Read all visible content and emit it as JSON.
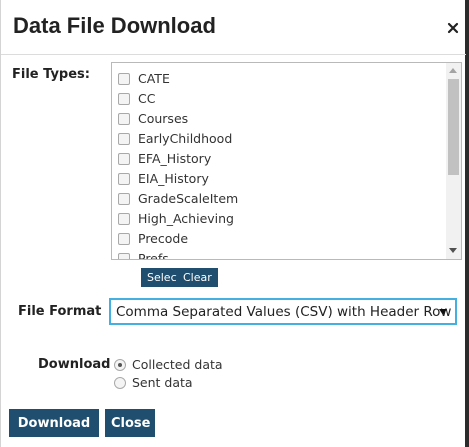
{
  "dialog": {
    "title": "Data File Download",
    "close_symbol": "×"
  },
  "file_types": {
    "label": "File Types:",
    "items": [
      {
        "label": "CATE",
        "checked": false
      },
      {
        "label": "CC",
        "checked": false
      },
      {
        "label": "Courses",
        "checked": false
      },
      {
        "label": "EarlyChildhood",
        "checked": false
      },
      {
        "label": "EFA_History",
        "checked": false
      },
      {
        "label": "EIA_History",
        "checked": false
      },
      {
        "label": "GradeScaleItem",
        "checked": false
      },
      {
        "label": "High_Achieving",
        "checked": false
      },
      {
        "label": "Precode",
        "checked": false
      },
      {
        "label": "Prefs",
        "checked": false
      }
    ],
    "select_all_label": "Select All",
    "clear_label": "Clear"
  },
  "file_format": {
    "label": "File Format",
    "selected": "Comma Separated Values (CSV) with Header Row"
  },
  "download_option": {
    "label": "Download",
    "options": [
      {
        "label": "Collected data",
        "selected": true
      },
      {
        "label": "Sent data",
        "selected": false
      }
    ]
  },
  "actions": {
    "download_label": "Download",
    "close_label": "Close"
  },
  "colors": {
    "button_bg": "#1f4e6e",
    "select_focus_border": "#43b0e0"
  },
  "icons": {
    "close": "close-icon",
    "dropdown": "chevron-down-icon"
  }
}
